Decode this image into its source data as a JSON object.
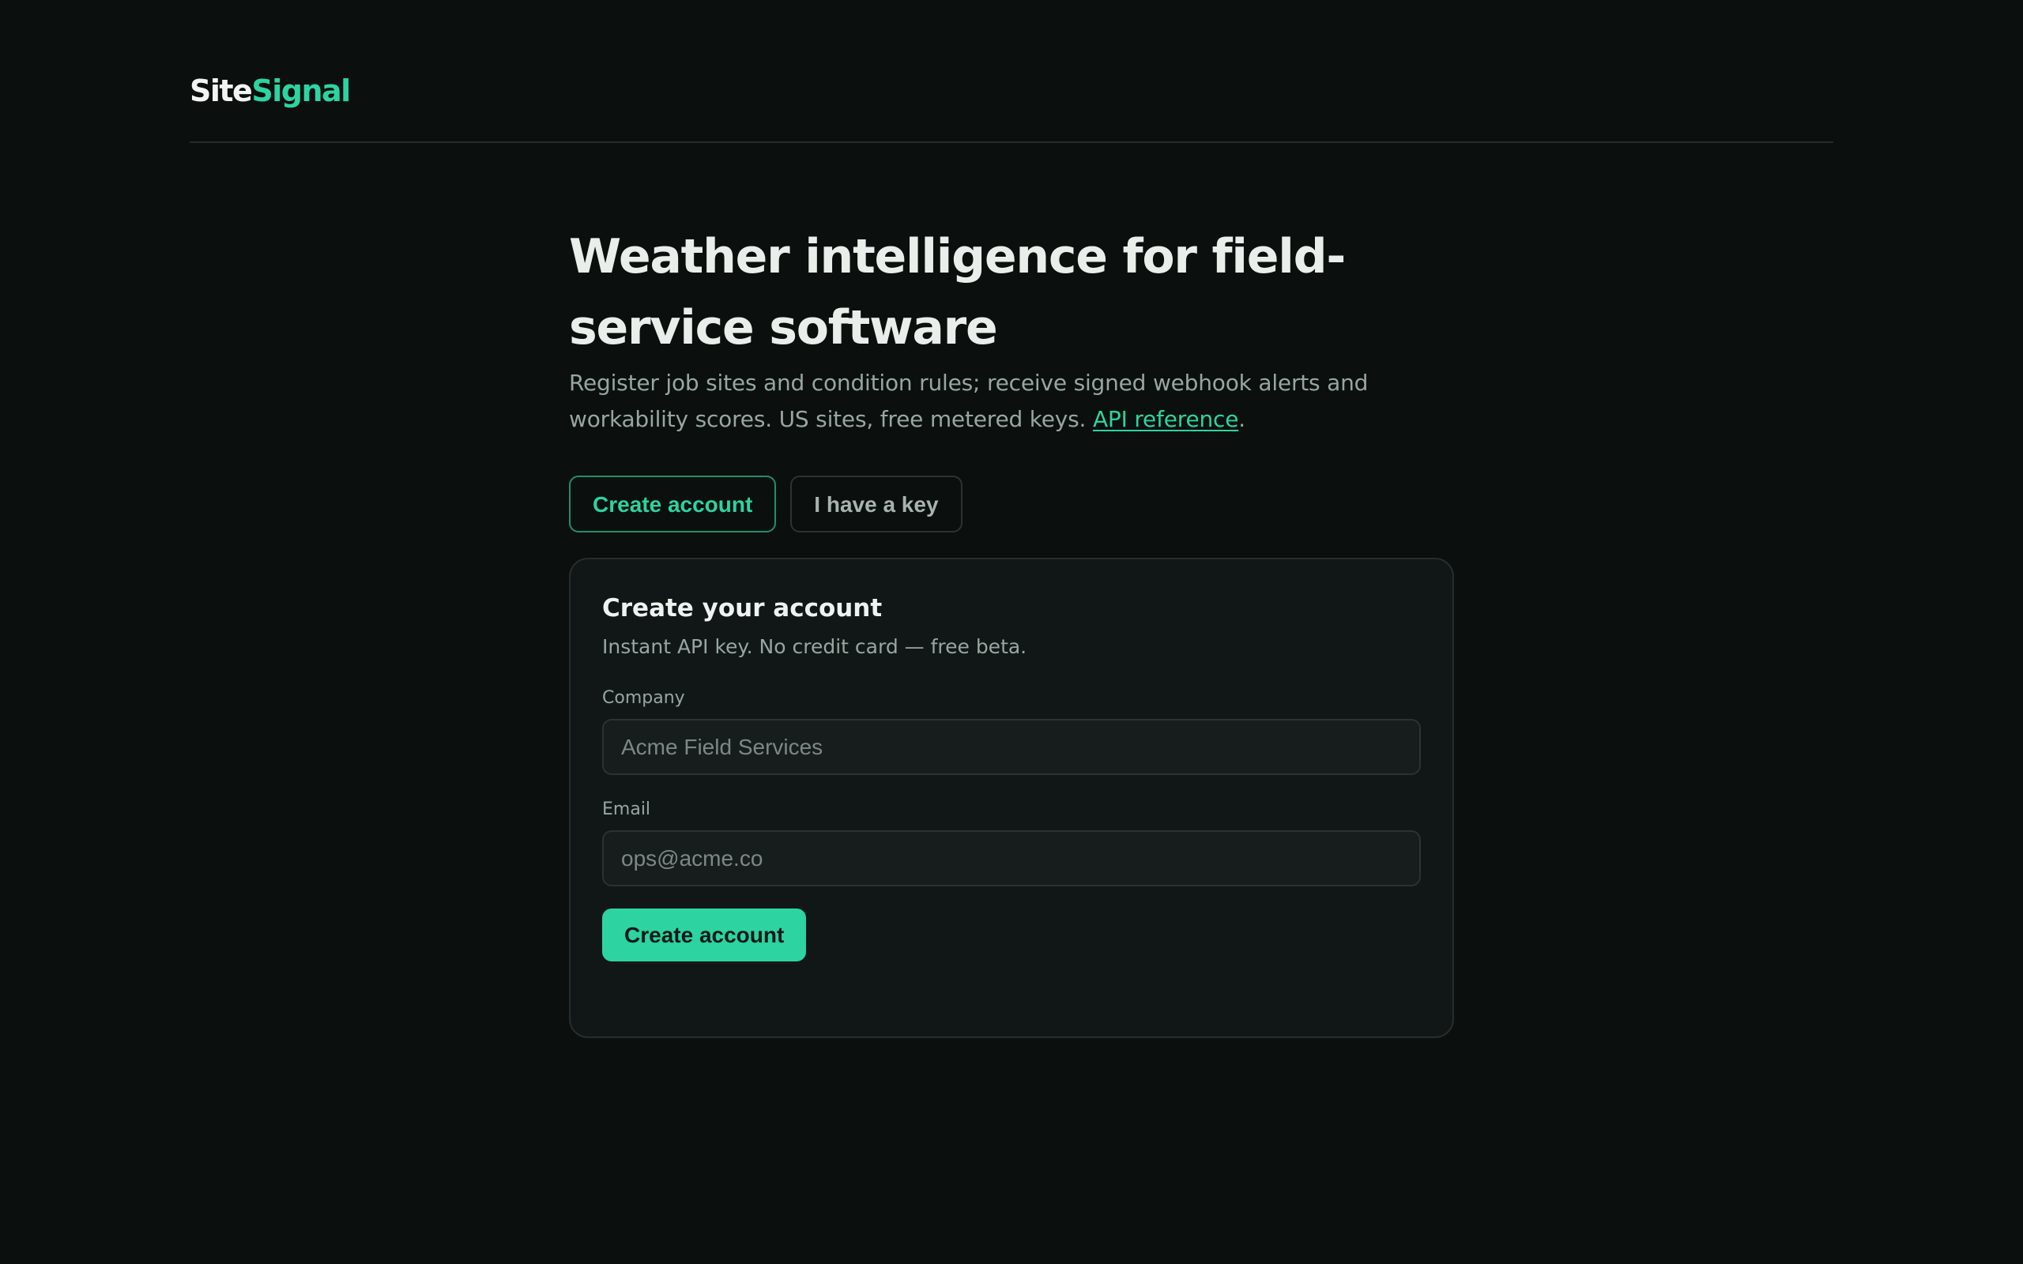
{
  "brand": {
    "name_part1": "Site",
    "name_part2": "Signal"
  },
  "hero": {
    "title": "Weather intelligence for field-service software",
    "description": "Register job sites and condition rules; receive signed webhook alerts and workability scores. US sites, free metered keys. ",
    "link_text": "API reference",
    "trailing": "."
  },
  "tabs": [
    {
      "label": "Create account",
      "active": true
    },
    {
      "label": "I have a key",
      "active": false
    }
  ],
  "form": {
    "title": "Create your account",
    "subtitle": "Instant API key. No credit card — free beta.",
    "company": {
      "label": "Company",
      "value": "",
      "placeholder": "Acme Field Services"
    },
    "email": {
      "label": "Email",
      "value": "",
      "placeholder": "ops@acme.co"
    },
    "submit_label": "Create account"
  },
  "colors": {
    "background": "#0b0f0e",
    "accent": "#2dd3a0",
    "card": "#111716",
    "muted_text": "#98a6a0"
  }
}
